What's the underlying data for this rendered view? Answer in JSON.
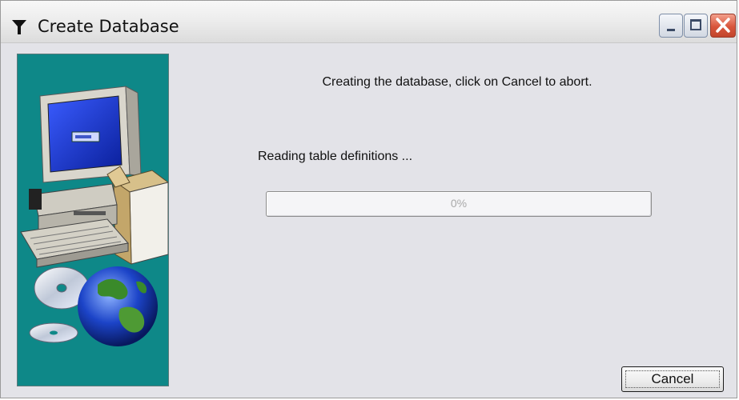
{
  "window": {
    "title": "Create Database",
    "controls": {
      "minimize_icon": "minimize-icon",
      "maximize_icon": "maximize-icon",
      "close_icon": "close-icon"
    }
  },
  "side_panel": {
    "illustration": "computer-and-globe-illustration",
    "background_color": "#0e8888"
  },
  "main": {
    "message": "Creating the database, click on Cancel to abort.",
    "status": "Reading table definitions ...",
    "progress": {
      "value": 0,
      "label": "0%"
    }
  },
  "buttons": {
    "cancel_label": "Cancel"
  },
  "colors": {
    "window_bg": "#e3e3e8",
    "close_button": "#d8563c"
  }
}
